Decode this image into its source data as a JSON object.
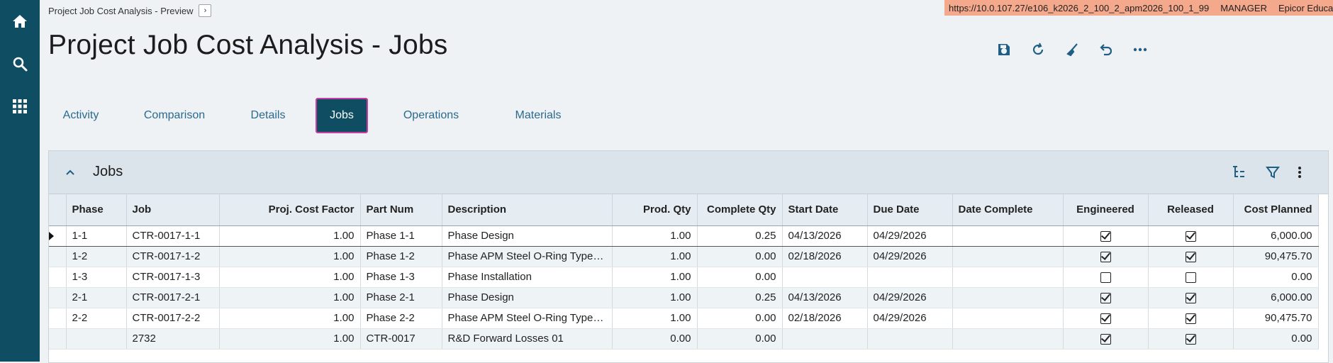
{
  "app": {
    "breadcrumb": "Project Job Cost Analysis - Preview",
    "url": "https://10.0.107.27/e106_k2026_2_100_2_apm2026_100_1_99",
    "user": "MANAGER",
    "company": "Epicor Educat",
    "title": "Project Job Cost Analysis - Jobs"
  },
  "rail": [
    "home-icon",
    "search-icon",
    "apps-grid-icon"
  ],
  "toolbar": [
    "save-icon",
    "refresh-icon",
    "clear-icon",
    "undo-icon",
    "more-icon"
  ],
  "tabs": [
    {
      "label": "Activity"
    },
    {
      "label": "Comparison"
    },
    {
      "label": "Details"
    },
    {
      "label": "Jobs",
      "active": true
    },
    {
      "label": "Operations"
    },
    {
      "label": "Materials"
    }
  ],
  "panel": {
    "title": "Jobs",
    "icons": [
      "tree-view-icon",
      "filter-icon",
      "kebab-menu-icon"
    ]
  },
  "grid": {
    "columns": [
      "Phase",
      "Job",
      "Proj. Cost Factor",
      "Part Num",
      "Description",
      "Prod. Qty",
      "Complete Qty",
      "Start Date",
      "Due Date",
      "Date Complete",
      "Engineered",
      "Released",
      "Cost Planned"
    ],
    "rows": [
      {
        "phase": "1-1",
        "job": "CTR-0017-1-1",
        "factor": "1.00",
        "part": "Phase 1-1",
        "desc": "Phase Design",
        "prod_qty": "1.00",
        "complete_qty": "0.25",
        "start": "04/13/2026",
        "due": "04/29/2026",
        "completed": "",
        "engineered": true,
        "released": true,
        "cost": "6,000.00"
      },
      {
        "phase": "1-2",
        "job": "CTR-0017-1-2",
        "factor": "1.00",
        "part": "Phase 1-2",
        "desc": "Phase APM Steel O-Ring Type…",
        "prod_qty": "1.00",
        "complete_qty": "0.00",
        "start": "02/18/2026",
        "due": "04/29/2026",
        "completed": "",
        "engineered": true,
        "released": true,
        "cost": "90,475.70"
      },
      {
        "phase": "1-3",
        "job": "CTR-0017-1-3",
        "factor": "1.00",
        "part": "Phase 1-3",
        "desc": "Phase Installation",
        "prod_qty": "1.00",
        "complete_qty": "0.00",
        "start": "",
        "due": "",
        "completed": "",
        "engineered": false,
        "released": false,
        "cost": "0.00"
      },
      {
        "phase": "2-1",
        "job": "CTR-0017-2-1",
        "factor": "1.00",
        "part": "Phase 2-1",
        "desc": "Phase Design",
        "prod_qty": "1.00",
        "complete_qty": "0.25",
        "start": "04/13/2026",
        "due": "04/29/2026",
        "completed": "",
        "engineered": true,
        "released": true,
        "cost": "6,000.00"
      },
      {
        "phase": "2-2",
        "job": "CTR-0017-2-2",
        "factor": "1.00",
        "part": "Phase 2-2",
        "desc": "Phase APM Steel O-Ring Type…",
        "prod_qty": "1.00",
        "complete_qty": "0.00",
        "start": "02/18/2026",
        "due": "04/29/2026",
        "completed": "",
        "engineered": true,
        "released": true,
        "cost": "90,475.70"
      },
      {
        "phase": "",
        "job": "2732",
        "factor": "1.00",
        "part": "CTR-0017",
        "desc": "R&D Forward Losses 01",
        "prod_qty": "0.00",
        "complete_qty": "0.00",
        "start": "",
        "due": "",
        "completed": "",
        "engineered": true,
        "released": true,
        "cost": "0.00"
      }
    ]
  }
}
